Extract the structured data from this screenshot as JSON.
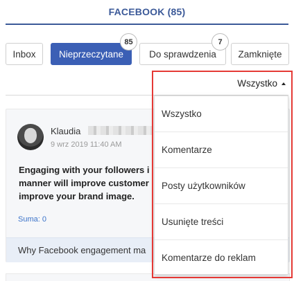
{
  "header": {
    "title": "FACEBOOK (85)"
  },
  "tabs": [
    {
      "label": "Inbox",
      "badge": ""
    },
    {
      "label": "Nieprzeczytane",
      "badge": "85",
      "active": true
    },
    {
      "label": "Do sprawdzenia",
      "badge": "7"
    },
    {
      "label": "Zamknięte",
      "badge": ""
    }
  ],
  "filter": {
    "selected": "Wszystko"
  },
  "dropdown": {
    "items": [
      {
        "label": "Wszystko"
      },
      {
        "label": "Komentarze"
      },
      {
        "label": "Posty użytkowników"
      },
      {
        "label": "Usunięte treści"
      },
      {
        "label": "Komentarze do reklam"
      }
    ]
  },
  "post": {
    "author": "Klaudia",
    "date": "9 wrz 2019 11:40 AM",
    "text": "Engaging with your followers i manner will improve customer improve your brand image.",
    "suma": "Suma: 0",
    "link_text": "Why Facebook engagement ma"
  },
  "colors": {
    "brand": "#3b5998",
    "active_tab": "#3b5fb5",
    "highlight": "#e53935",
    "link": "#3b73c9"
  }
}
